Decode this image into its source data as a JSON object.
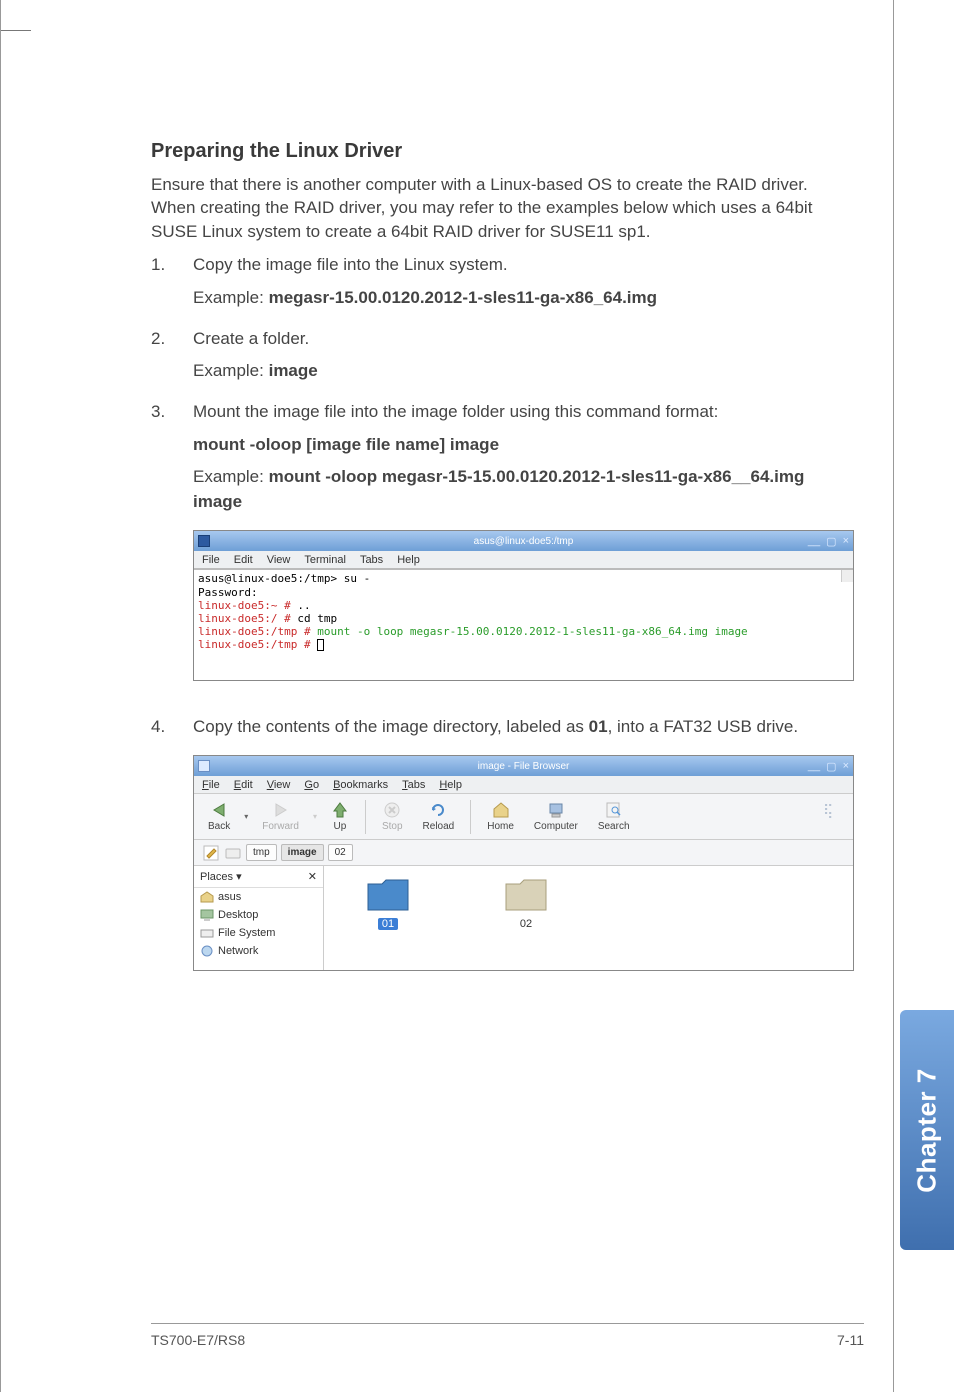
{
  "heading": "Preparing the Linux Driver",
  "intro": "Ensure that there is another computer with a Linux-based OS to create the RAID driver. When creating the RAID driver, you may refer to the examples below which uses a 64bit SUSE Linux system to create a 64bit RAID driver for SUSE11 sp1.",
  "steps": {
    "s1": {
      "num": "1.",
      "text": "Copy the image file into the Linux system.",
      "example_prefix": "Example:  ",
      "example_bold": "megasr-15.00.0120.2012-1-sles11-ga-x86_64.img"
    },
    "s2": {
      "num": "2.",
      "text": "Create a folder.",
      "example_prefix": "Example: ",
      "example_bold": "image"
    },
    "s3": {
      "num": "3.",
      "text": "Mount the image file into the image folder using this command format:",
      "cmd_bold": "mount -oloop [image file name] image",
      "example_prefix": "Example: ",
      "example_bold": "mount -oloop megasr-15-15.00.0120.2012-1-sles11-ga-x86__64.img image"
    },
    "s4": {
      "num": "4.",
      "text_a": "Copy the contents of the image directory, labeled as ",
      "text_b_bold": "01",
      "text_c": ", into  a FAT32 USB drive."
    }
  },
  "terminal": {
    "title": "asus@linux-doe5:/tmp",
    "win_buttons": {
      "min": "__",
      "max": "▢",
      "close": "×"
    },
    "menu": [
      "File",
      "Edit",
      "View",
      "Terminal",
      "Tabs",
      "Help"
    ],
    "lines": {
      "l1": "asus@linux-doe5:/tmp> su -",
      "l2": "Password:",
      "l3a": "linux-doe5:~ #",
      "l3b": " ..",
      "l4a": "linux-doe5:/ #",
      "l4b": " cd tmp",
      "l5a": "linux-doe5:/tmp #",
      "l5b": " mount -o loop megasr-15.00.0120.2012-1-sles11-ga-x86_64.img image",
      "l6a": "linux-doe5:/tmp #",
      "l6b": " "
    }
  },
  "filebrowser": {
    "title": "image - File Browser",
    "win_buttons": {
      "min": "__",
      "max": "▢",
      "close": "×"
    },
    "menu": [
      "File",
      "Edit",
      "View",
      "Go",
      "Bookmarks",
      "Tabs",
      "Help"
    ],
    "toolbar": {
      "back": "Back",
      "forward": "Forward",
      "up": "Up",
      "stop": "Stop",
      "reload": "Reload",
      "home": "Home",
      "computer": "Computer",
      "search": "Search"
    },
    "path": [
      "tmp",
      "image",
      "02"
    ],
    "side_head": "Places",
    "side_close": "✕",
    "side_items": [
      "asus",
      "Desktop",
      "File System",
      "Network"
    ],
    "folders": {
      "f1": "01",
      "f2": "02"
    }
  },
  "chapter_tab": "Chapter 7",
  "footer": {
    "left": "TS700-E7/RS8",
    "right": "7-11"
  }
}
